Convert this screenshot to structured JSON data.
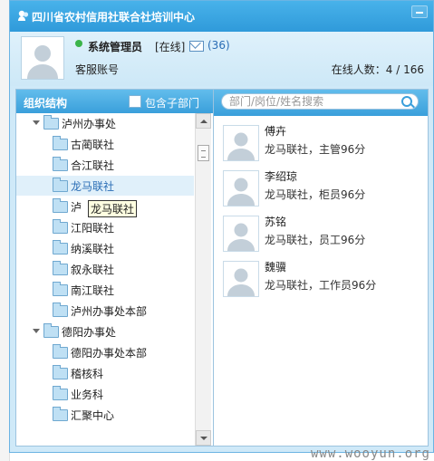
{
  "window": {
    "title": "四川省农村信用社联合社培训中心"
  },
  "user": {
    "name": "系统管理员",
    "status": "[在线]",
    "mail_count": "(36)",
    "account": "客服账号",
    "online_label": "在线人数：",
    "online_value": "4 / 166"
  },
  "org": {
    "title": "组织结构",
    "include_sub_label": "包含子部门",
    "nodes": [
      {
        "label": "泸州办事处",
        "level": 0,
        "expanded": true
      },
      {
        "label": "古蔺联社",
        "level": 1
      },
      {
        "label": "合江联社",
        "level": 1
      },
      {
        "label": "龙马联社",
        "level": 1,
        "selected": true
      },
      {
        "label": "泸",
        "level": 1
      },
      {
        "label": "江阳联社",
        "level": 1
      },
      {
        "label": "纳溪联社",
        "level": 1
      },
      {
        "label": "叙永联社",
        "level": 1
      },
      {
        "label": "南江联社",
        "level": 1
      },
      {
        "label": "泸州办事处本部",
        "level": 1
      },
      {
        "label": "德阳办事处",
        "level": 0,
        "expanded": true
      },
      {
        "label": "德阳办事处本部",
        "level": 1
      },
      {
        "label": "稽核科",
        "level": 1
      },
      {
        "label": "业务科",
        "level": 1
      },
      {
        "label": "汇聚中心",
        "level": 1
      }
    ],
    "tooltip": "龙马联社"
  },
  "search": {
    "placeholder": "部门/岗位/姓名搜索"
  },
  "people": [
    {
      "name": "傅卉",
      "desc": "龙马联社，主管96分"
    },
    {
      "name": "李绍琼",
      "desc": "龙马联社，柜员96分"
    },
    {
      "name": "苏铭",
      "desc": "龙马联社，员工96分"
    },
    {
      "name": "魏骥",
      "desc": "龙马联社，工作员96分"
    }
  ],
  "watermark": "www.wooyun.org"
}
